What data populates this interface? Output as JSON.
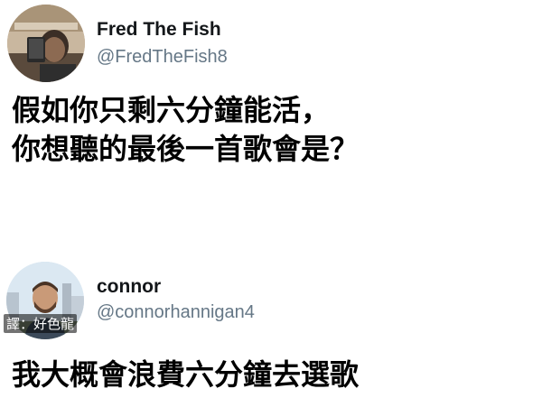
{
  "tweets": [
    {
      "display_name": "Fred The Fish",
      "handle": "@FredTheFish8",
      "text": "假如你只剩六分鐘能活，\n你想聽的最後一首歌會是？",
      "avatar_icon": "user-avatar-selfie"
    },
    {
      "display_name": "connor",
      "handle": "@connorhannigan4",
      "text": "我大概會浪費六分鐘去選歌",
      "avatar_icon": "user-avatar-photo"
    }
  ],
  "watermark": "譯：好色龍",
  "colors": {
    "handle": "#657786",
    "name": "#14171a",
    "background": "#ffffff"
  }
}
